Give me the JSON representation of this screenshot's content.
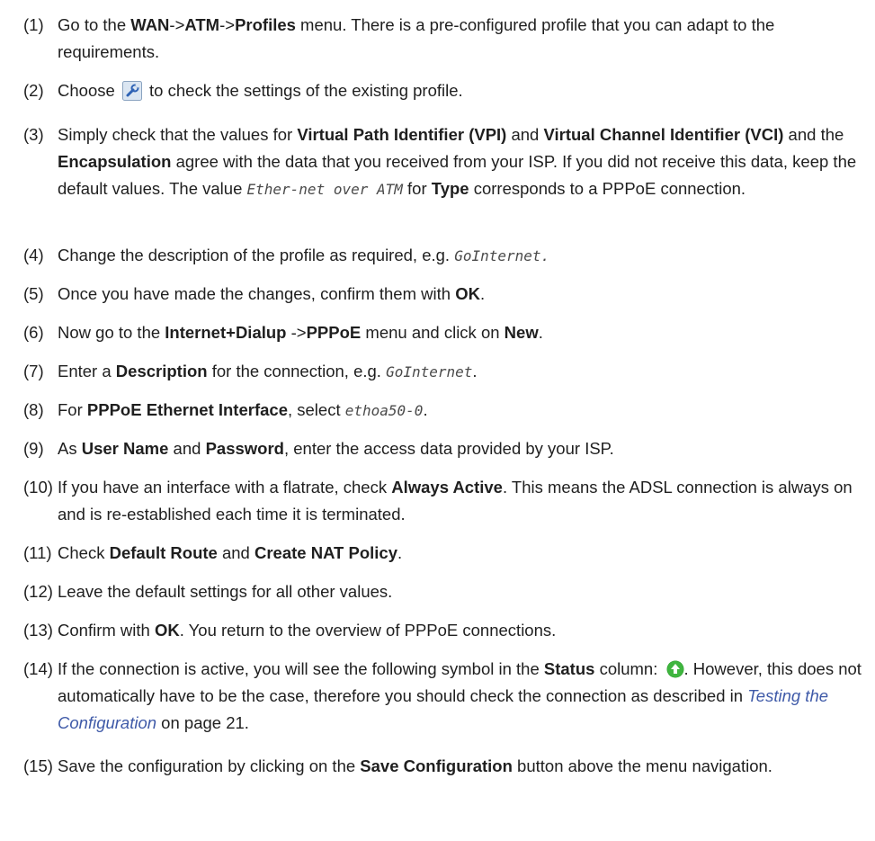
{
  "steps": [
    {
      "n": "(1)",
      "parts": [
        "Go to the ",
        "WAN",
        "->",
        "ATM",
        "->",
        "Profiles",
        " menu. There is a pre-configured profile that you can adapt to the requirements."
      ]
    },
    {
      "n": "(2)",
      "parts": [
        "Choose ",
        " to check the settings of the existing profile."
      ]
    },
    {
      "n": "(3)",
      "parts": [
        "Simply check that the values for ",
        "Virtual Path Identifier (VPI)",
        " and ",
        "Virtual Channel Identifier (VCI)",
        " and the ",
        "Encapsulation",
        " agree with the data that you received from your ISP. If you did not receive this data, keep the default values. The value ",
        "Ether-net over ATM",
        " for ",
        "Type",
        " corresponds to a PPPoE connection."
      ]
    },
    {
      "n": "(4)",
      "parts": [
        "Change the description of the profile as required, e.g. ",
        "GoInternet."
      ]
    },
    {
      "n": "(5)",
      "parts": [
        "Once you have made the changes, confirm them with ",
        "OK",
        "."
      ]
    },
    {
      "n": "(6)",
      "parts": [
        "Now go to the ",
        "Internet+Dialup",
        " ->",
        "PPPoE",
        " menu and click on ",
        "New",
        "."
      ]
    },
    {
      "n": "(7)",
      "parts": [
        "Enter a ",
        "Description",
        " for the connection, e.g. ",
        "GoInternet",
        "."
      ]
    },
    {
      "n": "(8)",
      "parts": [
        "For ",
        "PPPoE Ethernet Interface",
        ", select ",
        "ethoa50-0",
        "."
      ]
    },
    {
      "n": "(9)",
      "parts": [
        "As ",
        "User Name",
        " and ",
        "Password",
        ", enter the access data provided by your ISP."
      ]
    },
    {
      "n": "(10)",
      "parts": [
        "If you have an interface with a flatrate, check ",
        "Always Active",
        ". This means the ADSL connection is always on and is re-established each time it is terminated."
      ]
    },
    {
      "n": "(11)",
      "parts": [
        "Check ",
        "Default Route",
        " and ",
        "Create NAT Policy",
        "."
      ]
    },
    {
      "n": "(12)",
      "parts": [
        "Leave the default settings for all other values."
      ]
    },
    {
      "n": "(13)",
      "parts": [
        "Confirm with ",
        "OK",
        ". You return to the overview of PPPoE connections."
      ]
    },
    {
      "n": "(14)",
      "parts": [
        "If the connection is active, you will see the following symbol in the ",
        "Status",
        " column: ",
        ". However, this does not automatically have to be the case, therefore you should check the connection as described in ",
        "Testing the Configuration",
        " on page 21."
      ]
    },
    {
      "n": "(15)",
      "parts": [
        "Save the configuration by clicking on the ",
        "Save Configuration",
        " button above the menu navigation."
      ]
    }
  ],
  "icons": {
    "edit_icon": "wrench-icon",
    "status_icon": "status-active-icon"
  },
  "colors": {
    "link": "#3f5aa8",
    "status_green": "#2e9e2e"
  }
}
